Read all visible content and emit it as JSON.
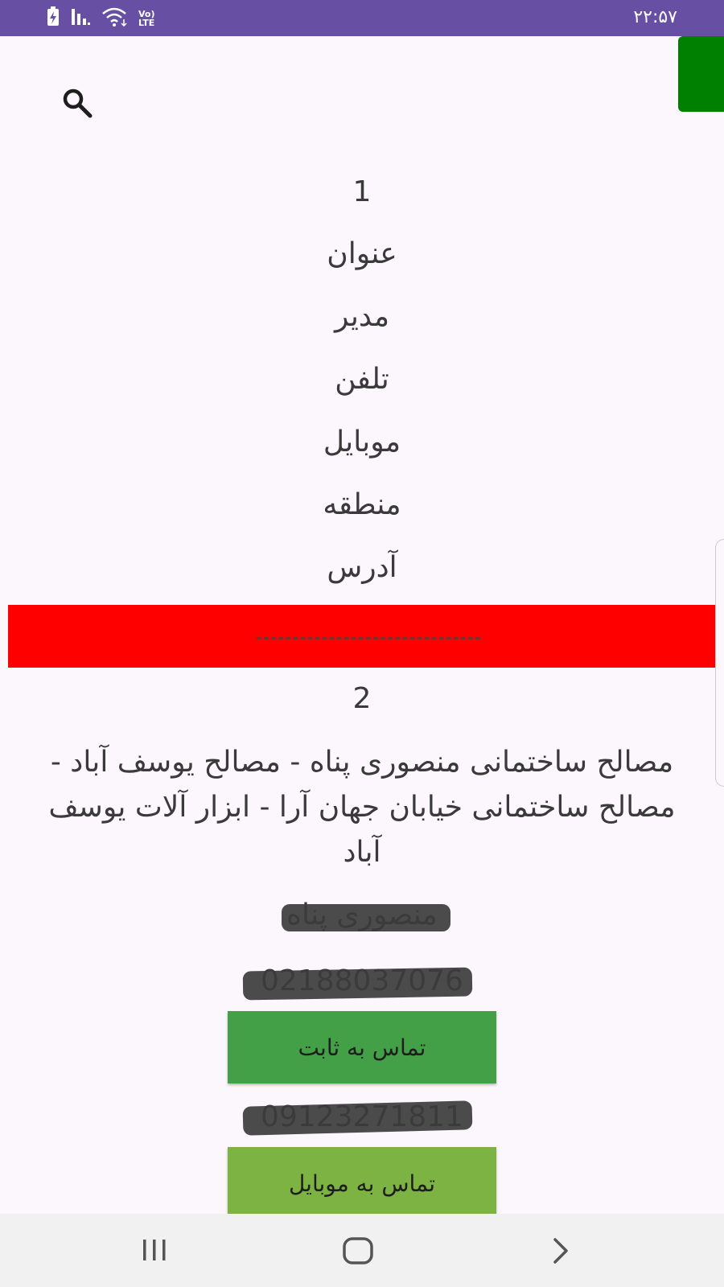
{
  "status_bar": {
    "time": "۲۲:۵۷",
    "network_label": "Vo) LTE",
    "icons": [
      "battery-charging-icon",
      "signal-icon",
      "wifi-icon"
    ]
  },
  "record_1": {
    "number": "1",
    "title": "عنوان",
    "manager": "مدیر",
    "phone": "تلفن",
    "mobile": "موبایل",
    "area": "منطقه",
    "address": "آدرس"
  },
  "record_2": {
    "number": "2",
    "title": "مصالح ساختمانی منصوری پناه - مصالح یوسف آباد - مصالح ساختمانی خیابان جهان آرا - ابزار آلات یوسف آباد",
    "manager": "منصوری پناه",
    "phone": "02188037076",
    "call_landline_label": "تماس به ثابت",
    "mobile": "09123271811",
    "call_mobile_label": "تماس به موبایل"
  },
  "colors": {
    "status_bar": "#6750a4",
    "green_block": "#008000",
    "separator": "#ff0000",
    "landline_button": "#43a047",
    "mobile_button": "#7cb342"
  }
}
